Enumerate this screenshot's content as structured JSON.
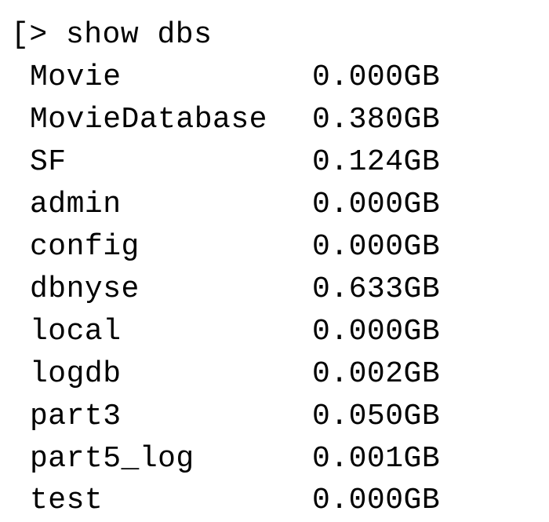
{
  "prompt": {
    "bracket": "[",
    "chevron": ">",
    "command": "show dbs"
  },
  "databases": [
    {
      "name": "Movie",
      "size": "0.000GB"
    },
    {
      "name": "MovieDatabase",
      "size": "0.380GB"
    },
    {
      "name": "SF",
      "size": "0.124GB"
    },
    {
      "name": "admin",
      "size": "0.000GB"
    },
    {
      "name": "config",
      "size": "0.000GB"
    },
    {
      "name": "dbnyse",
      "size": "0.633GB"
    },
    {
      "name": "local",
      "size": "0.000GB"
    },
    {
      "name": "logdb",
      "size": "0.002GB"
    },
    {
      "name": "part3",
      "size": "0.050GB"
    },
    {
      "name": "part5_log",
      "size": "0.001GB"
    },
    {
      "name": "test",
      "size": "0.000GB"
    }
  ]
}
